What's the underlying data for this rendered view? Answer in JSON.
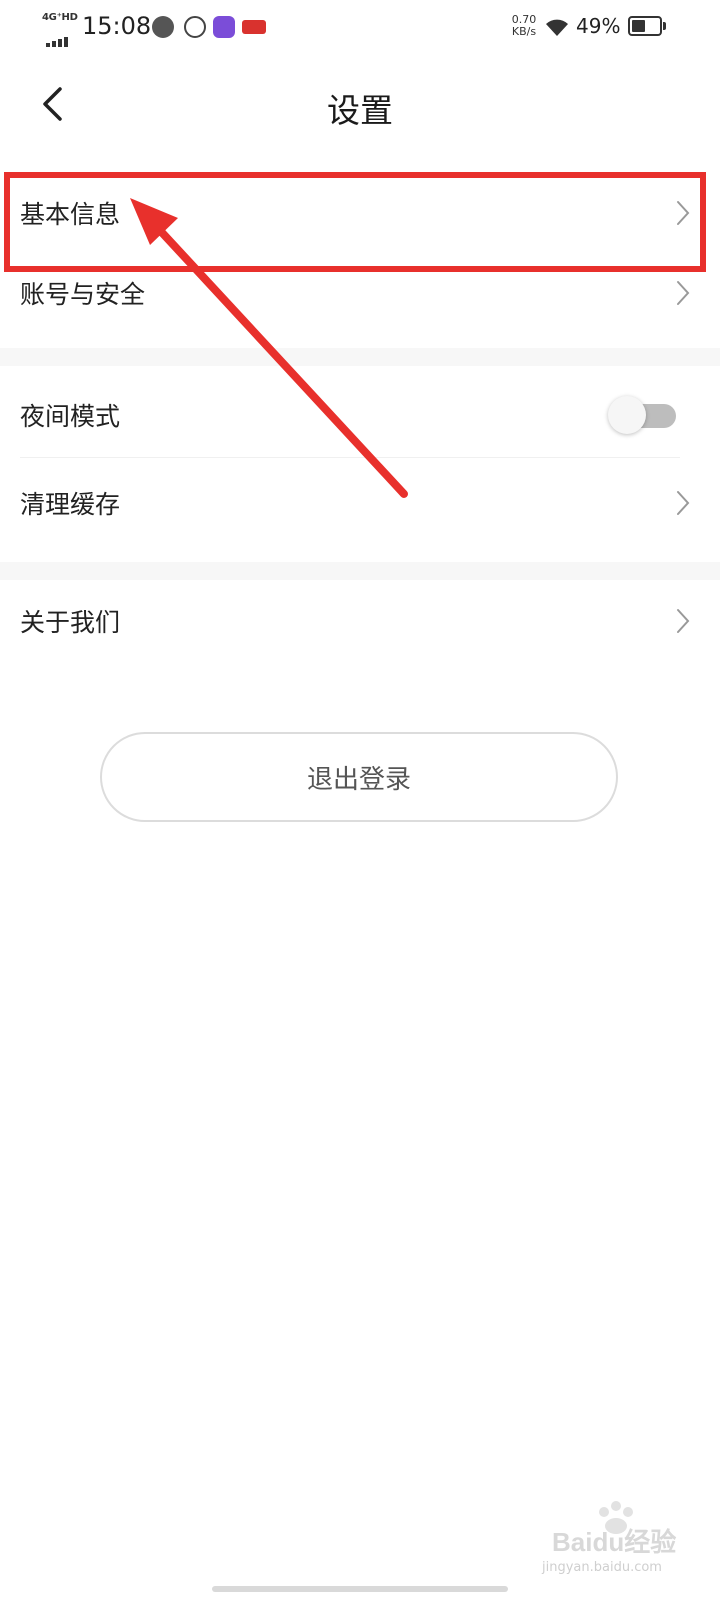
{
  "status_bar": {
    "network": "4G⁺HD",
    "time": "15:08",
    "speed_value": "0.70",
    "speed_unit": "KB/s",
    "battery": "49%",
    "battery_level": 0.49
  },
  "header": {
    "title": "设置",
    "back_icon": "chevron-left-icon"
  },
  "menu": {
    "basic_info": "基本信息",
    "account_security": "账号与安全",
    "night_mode": "夜间模式",
    "night_mode_enabled": false,
    "clear_cache": "清理缓存",
    "about_us": "关于我们"
  },
  "logout": {
    "label": "退出登录"
  },
  "watermark": {
    "text": "Baidu经验",
    "url": "jingyan.baidu.com"
  },
  "colors": {
    "annotation": "#e8302c",
    "toggle_off": "#bdbdbd"
  }
}
